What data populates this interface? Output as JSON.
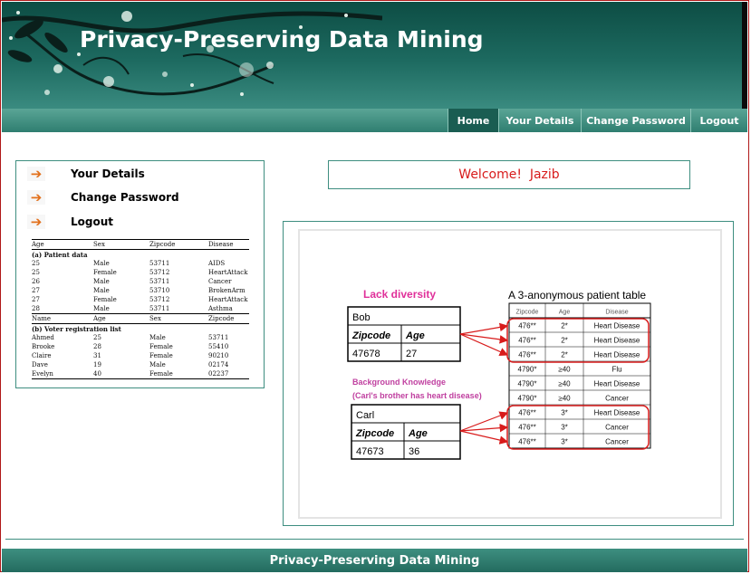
{
  "header": {
    "title": "Privacy-Preserving Data Mining"
  },
  "nav": {
    "items": [
      {
        "label": "Home",
        "active": true
      },
      {
        "label": "Your Details",
        "active": false
      },
      {
        "label": "Change Password",
        "active": false
      },
      {
        "label": "Logout",
        "active": false
      }
    ]
  },
  "sidebar": {
    "items": [
      {
        "label": "Your Details",
        "icon": "arrow-right-icon"
      },
      {
        "label": "Change Password",
        "icon": "arrow-right-icon"
      },
      {
        "label": "Logout",
        "icon": "arrow-right-icon"
      }
    ]
  },
  "mini_tables": {
    "patient_header": [
      "Age",
      "Sex",
      "Zipcode",
      "Disease"
    ],
    "patient_caption": "(a) Patient data",
    "patient_rows": [
      [
        "25",
        "Male",
        "53711",
        "AIDS"
      ],
      [
        "25",
        "Female",
        "53712",
        "HeartAttack"
      ],
      [
        "26",
        "Male",
        "53711",
        "Cancer"
      ],
      [
        "27",
        "Male",
        "53710",
        "BrokenArm"
      ],
      [
        "27",
        "Female",
        "53712",
        "HeartAttack"
      ],
      [
        "28",
        "Male",
        "53711",
        "Asthma"
      ]
    ],
    "voter_header": [
      "Name",
      "Age",
      "Sex",
      "Zipcode"
    ],
    "voter_caption": "(b) Voter registration list",
    "voter_rows": [
      [
        "Ahmed",
        "25",
        "Male",
        "53711"
      ],
      [
        "Brooke",
        "28",
        "Female",
        "55410"
      ],
      [
        "Claire",
        "31",
        "Female",
        "90210"
      ],
      [
        "Dave",
        "19",
        "Male",
        "02174"
      ],
      [
        "Evelyn",
        "40",
        "Female",
        "02237"
      ]
    ]
  },
  "welcome": {
    "text": "Welcome!  Jazib"
  },
  "figure": {
    "lack_diversity": "Lack diversity",
    "table_title": "A 3-anonymous patient table",
    "bob": {
      "name": "Bob",
      "zip_label": "Zipcode",
      "age_label": "Age",
      "zip": "47678",
      "age": "27"
    },
    "background_1": "Background Knowledge",
    "background_2": "(Carl's brother has heart disease)",
    "carl": {
      "name": "Carl",
      "zip_label": "Zipcode",
      "age_label": "Age",
      "zip": "47673",
      "age": "36"
    },
    "anon_header": [
      "Zipcode",
      "Age",
      "Disease"
    ],
    "anon_rows": [
      [
        "476**",
        "2*",
        "Heart Disease"
      ],
      [
        "476**",
        "2*",
        "Heart Disease"
      ],
      [
        "476**",
        "2*",
        "Heart Disease"
      ],
      [
        "4790*",
        "≥40",
        "Flu"
      ],
      [
        "4790*",
        "≥40",
        "Heart Disease"
      ],
      [
        "4790*",
        "≥40",
        "Cancer"
      ],
      [
        "476**",
        "3*",
        "Heart Disease"
      ],
      [
        "476**",
        "3*",
        "Cancer"
      ],
      [
        "476**",
        "3*",
        "Cancer"
      ]
    ],
    "colors": {
      "pink": "#e0309a",
      "red": "#d81b1b",
      "purple": "#c040a0"
    }
  },
  "footer": {
    "text": "Privacy-Preserving Data Mining"
  }
}
